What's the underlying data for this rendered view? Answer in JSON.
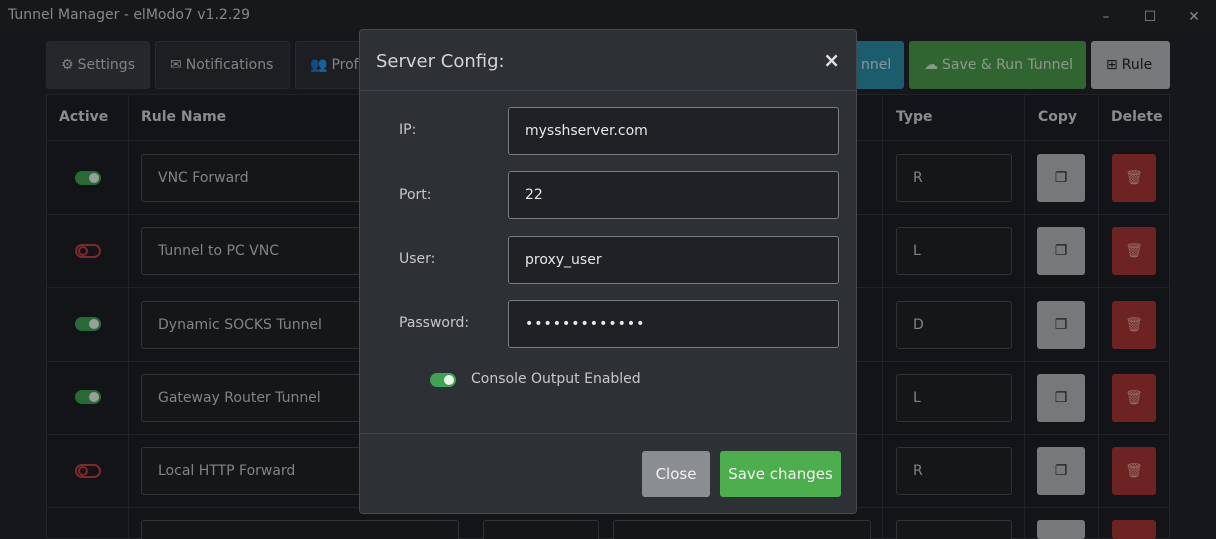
{
  "window": {
    "title": "Tunnel Manager - elModo7 v1.2.29",
    "minimize": "–",
    "maximize": "☐",
    "close": "✕"
  },
  "toolbar": {
    "settings": "Settings",
    "notifications": "Notifications",
    "profiles": "Prof",
    "run_tunnel_partial": "nnel",
    "save_run": "Save & Run Tunnel",
    "rule": "Rule"
  },
  "table": {
    "headers": {
      "active": "Active",
      "rule_name": "Rule Name",
      "type": "Type",
      "copy": "Copy",
      "delete": "Delete"
    },
    "rows": [
      {
        "active": true,
        "name": "VNC Forward",
        "type": "R"
      },
      {
        "active": false,
        "name": "Tunnel to PC VNC",
        "type": "L"
      },
      {
        "active": true,
        "name": "Dynamic SOCKS Tunnel",
        "type": "D"
      },
      {
        "active": true,
        "name": "Gateway Router Tunnel",
        "type": "L"
      },
      {
        "active": false,
        "name": "Local HTTP Forward",
        "type": "R"
      }
    ]
  },
  "modal": {
    "title": "Server Config:",
    "close_x": "×",
    "fields": {
      "ip_label": "IP:",
      "ip_value": "mysshserver.com",
      "port_label": "Port:",
      "port_value": "22",
      "user_label": "User:",
      "user_value": "proxy_user",
      "password_label": "Password:",
      "password_value": "•••••••••••••"
    },
    "console_output_label": "Console Output Enabled",
    "console_output_enabled": true,
    "close_button": "Close",
    "save_button": "Save changes"
  },
  "colors": {
    "accent_green": "#4cae4c",
    "danger_red": "#a83733",
    "info_teal": "#2a8fa8"
  }
}
